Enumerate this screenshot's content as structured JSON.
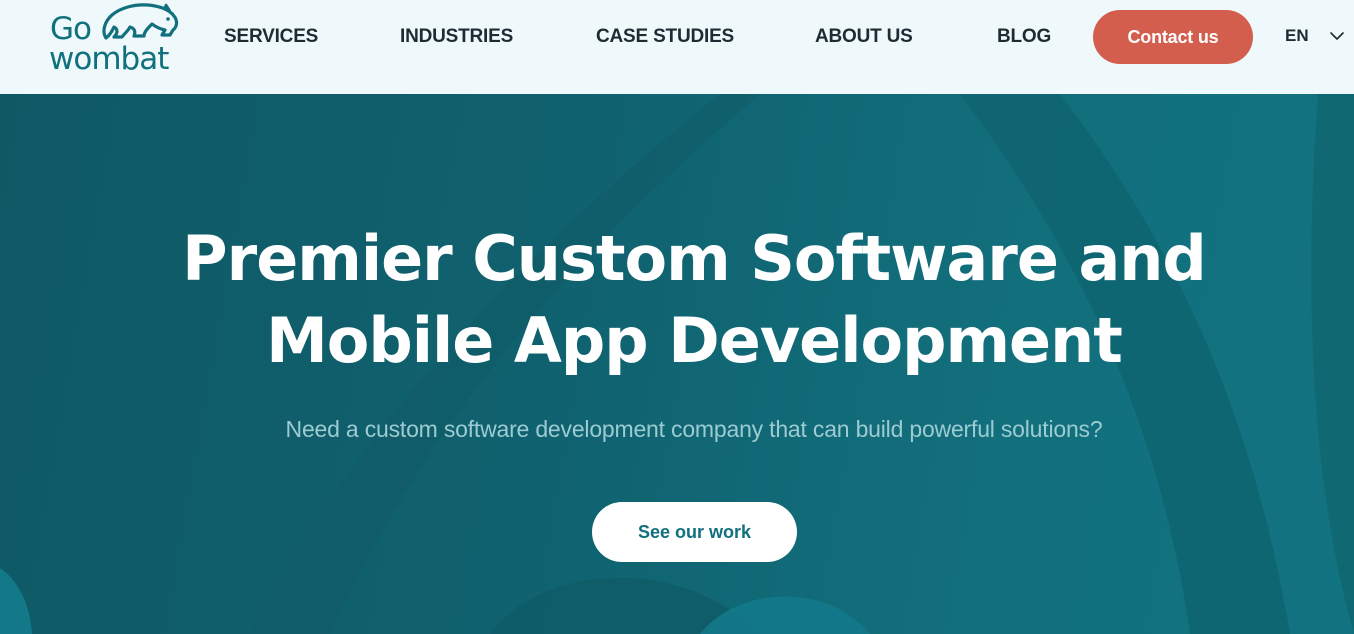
{
  "brand": {
    "name_line1": "Go",
    "name_line2": "wombat",
    "mascot_icon": "wombat-icon",
    "color": "#11707e"
  },
  "nav": {
    "items": [
      {
        "label": "SERVICES"
      },
      {
        "label": "INDUSTRIES"
      },
      {
        "label": "CASE STUDIES"
      },
      {
        "label": "ABOUT US"
      },
      {
        "label": "BLOG"
      }
    ],
    "contact_label": "Contact us",
    "contact_color": "#d35e4d",
    "language": {
      "selected": "EN",
      "icon": "chevron-down-icon"
    }
  },
  "hero": {
    "title_line1": "Premier Custom Software and",
    "title_line2": "Mobile App Development",
    "subtitle": "Need a custom software development company that can build powerful solutions?",
    "cta_label": "See our work",
    "background_color": "#10616f"
  }
}
